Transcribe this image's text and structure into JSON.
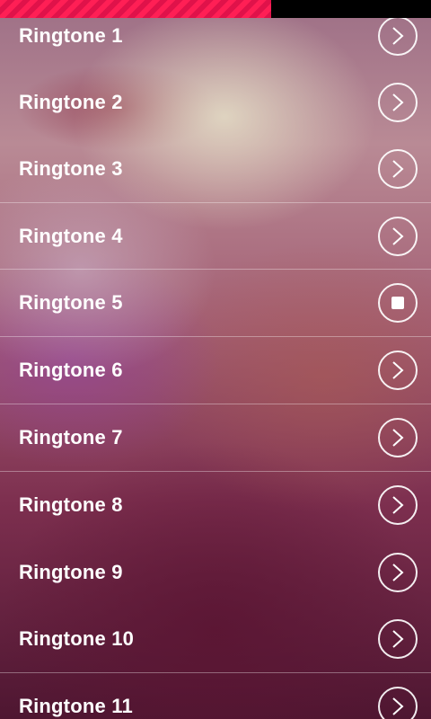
{
  "playback": {
    "progress_fraction": 0.63,
    "progress_color": "#ff1f55"
  },
  "ringtones": [
    {
      "label": "Ringtone 1",
      "state": "play",
      "icon": "chevron-right-icon"
    },
    {
      "label": "Ringtone 2",
      "state": "play",
      "icon": "chevron-right-icon"
    },
    {
      "label": "Ringtone 3",
      "state": "play",
      "icon": "chevron-right-icon"
    },
    {
      "label": "Ringtone 4",
      "state": "play",
      "icon": "chevron-right-icon"
    },
    {
      "label": "Ringtone 5",
      "state": "stop",
      "icon": "stop-icon"
    },
    {
      "label": "Ringtone 6",
      "state": "play",
      "icon": "chevron-right-icon"
    },
    {
      "label": "Ringtone 7",
      "state": "play",
      "icon": "chevron-right-icon"
    },
    {
      "label": "Ringtone 8",
      "state": "play",
      "icon": "chevron-right-icon"
    },
    {
      "label": "Ringtone 9",
      "state": "play",
      "icon": "chevron-right-icon"
    },
    {
      "label": "Ringtone 10",
      "state": "play",
      "icon": "chevron-right-icon"
    },
    {
      "label": "Ringtone 11",
      "state": "play",
      "icon": "chevron-right-icon"
    }
  ]
}
